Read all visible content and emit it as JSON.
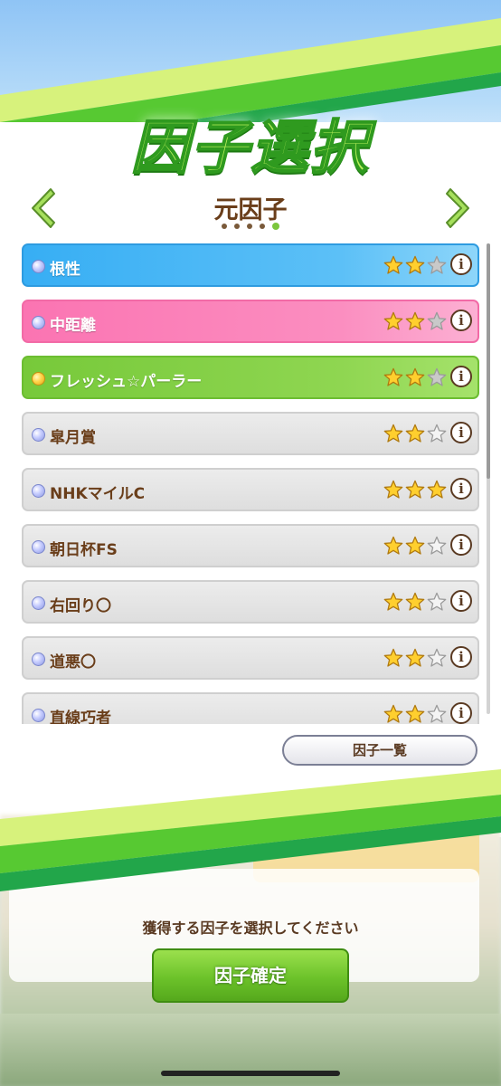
{
  "header": {
    "title": "因子選択",
    "subtitle": "元因子",
    "pager": {
      "total": 5,
      "active_index": 4
    }
  },
  "factors": [
    {
      "name": "根性",
      "color": "blue",
      "stars_filled": 2,
      "stars_total": 3,
      "bullet": "blue"
    },
    {
      "name": "中距離",
      "color": "pink",
      "stars_filled": 2,
      "stars_total": 3,
      "bullet": "blue"
    },
    {
      "name": "フレッシュ☆パーラー",
      "color": "green",
      "stars_filled": 2,
      "stars_total": 3,
      "bullet": "gold"
    },
    {
      "name": "皐月賞",
      "color": "gray",
      "stars_filled": 2,
      "stars_total": 3,
      "bullet": "blue"
    },
    {
      "name": "NHKマイルC",
      "color": "gray",
      "stars_filled": 3,
      "stars_total": 3,
      "bullet": "blue"
    },
    {
      "name": "朝日杯FS",
      "color": "gray",
      "stars_filled": 2,
      "stars_total": 3,
      "bullet": "blue"
    },
    {
      "name": "右回り〇",
      "color": "gray",
      "stars_filled": 2,
      "stars_total": 3,
      "bullet": "blue"
    },
    {
      "name": "道悪〇",
      "color": "gray",
      "stars_filled": 2,
      "stars_total": 3,
      "bullet": "blue"
    },
    {
      "name": "直線巧者",
      "color": "gray",
      "stars_filled": 2,
      "stars_total": 3,
      "bullet": "blue"
    }
  ],
  "info_label": "i",
  "buttons": {
    "factor_list": "因子一覧",
    "confirm": "因子確定"
  },
  "prompt": "獲得する因子を選択してください",
  "colors": {
    "accent_green": "#6cc22a",
    "text_brown": "#5a3a22",
    "blue_row": "#37aef4",
    "pink_row": "#fb74b2",
    "green_row": "#77c93a"
  },
  "icons": {
    "prev": "chevron-left-icon",
    "next": "chevron-right-icon",
    "star": "star-icon",
    "info": "info-icon"
  }
}
